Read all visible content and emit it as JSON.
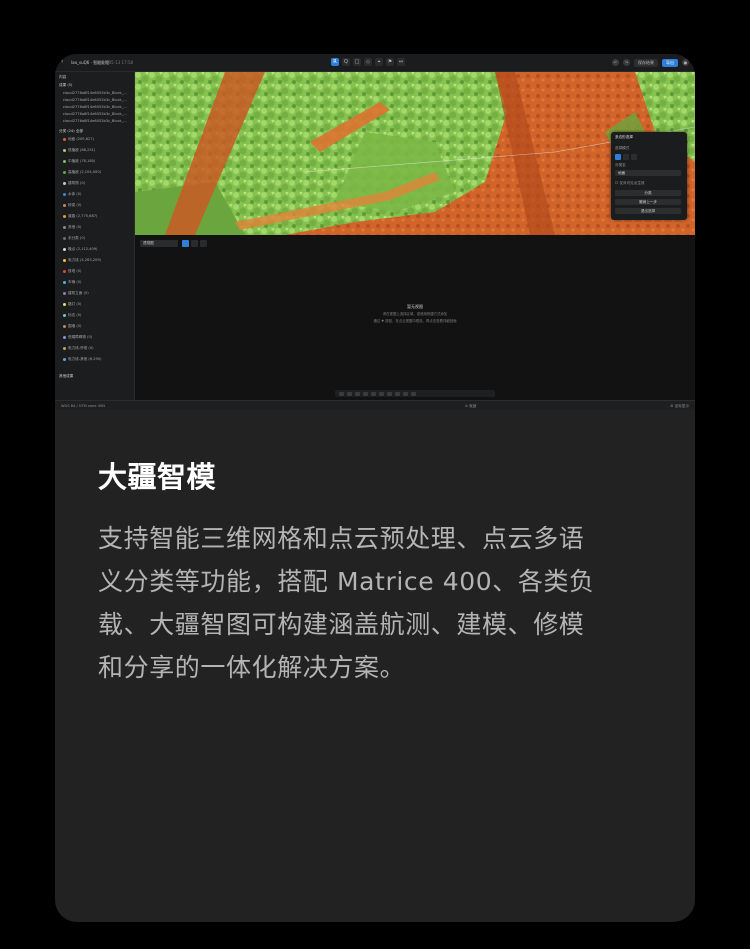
{
  "app": {
    "file_name": "lao_suQ6 · 智能处理",
    "file_time": "2025-05-13 17:58",
    "tools": [
      "R",
      "Q",
      "□",
      "◇",
      "⌖",
      "⚑",
      "↔"
    ],
    "undo_icon": "undo-icon",
    "redo_icon": "redo-icon",
    "secondary_button": "保存结果",
    "primary_button": "导出"
  },
  "sidebar": {
    "title": "内容",
    "section_results": "成果 (5)",
    "result_items": [
      "cloud2776a8f14e6052b3c_Block_...",
      "cloud2776a8f14e6052b3c_Block_...",
      "cloud2776a8f14e6052b3c_Block_...",
      "cloud2776a8f14e6052b3c_Block_...",
      "cloud2776a8f14e6052b3c_Block_..."
    ],
    "section_classes": "分类 (24) 全部",
    "class_items": [
      {
        "label": "地面 (209,627)",
        "color": "#e0632a"
      },
      {
        "label": "低植被 (88,251)",
        "color": "#9ed06c"
      },
      {
        "label": "中植被 (78,180)",
        "color": "#7bc25a"
      },
      {
        "label": "高植被 (2,104,000)",
        "color": "#5aa84a"
      },
      {
        "label": "建筑物 (0)",
        "color": "#c9c9c9"
      },
      {
        "label": "水体 (0)",
        "color": "#3c8ad8"
      },
      {
        "label": "桥梁 (0)",
        "color": "#b88a5a"
      },
      {
        "label": "道路 (2,775,687)",
        "color": "#e69a3c"
      },
      {
        "label": "其他 (0)",
        "color": "#8a8a8a"
      },
      {
        "label": "未分类 (0)",
        "color": "#6f6f6f"
      },
      {
        "label": "噪点 (2,112,409)",
        "color": "#d8d8d8"
      },
      {
        "label": "电力线 (4,283,209)",
        "color": "#f0c040"
      },
      {
        "label": "铁塔 (0)",
        "color": "#e04040"
      },
      {
        "label": "车辆 (0)",
        "color": "#4fb0e0"
      },
      {
        "label": "建筑立面 (0)",
        "color": "#a070d0"
      },
      {
        "label": "路灯 (0)",
        "color": "#e0e060"
      },
      {
        "label": "标志 (0)",
        "color": "#60d0c0"
      },
      {
        "label": "围墙 (0)",
        "color": "#d08060"
      },
      {
        "label": "低矮障碍物 (0)",
        "color": "#9090d0"
      },
      {
        "label": "电力线-杆塔 (0)",
        "color": "#c0a070"
      },
      {
        "label": "电力线-其他 (6,290)",
        "color": "#70a0c0"
      }
    ],
    "section_more": "其他成果"
  },
  "panel": {
    "title": "多边形选择",
    "label_mode": "选择模式",
    "label_class": "分类至",
    "class_value": "地面",
    "checkbox_label": "仅对可见点生效",
    "btn_apply": "分类",
    "btn_reset": "撤销上一步",
    "btn_exit": "退出选择"
  },
  "lower": {
    "select_value": "透视图",
    "empty_title": "暂无视图",
    "empty_line1": "请在视图上选择区域，或使用快捷方式添加",
    "empty_line2": "通过 ✚ 按钮，在点云视图中框选，再点击查看详细剖面"
  },
  "status": {
    "left": "WGS 84 / UTM zone 49N",
    "middle": "⊘ 就绪",
    "right": "⊞ 坐标显示"
  },
  "content": {
    "title": "大疆智模",
    "desc_lines": [
      "支持智能三维网格和点云预处理、点云多语",
      "义分类等功能，搭配 Matrice 400、各类负",
      "载、大疆智图可构建涵盖航测、建模、修模",
      "和分享的一体化解决方案。"
    ]
  }
}
